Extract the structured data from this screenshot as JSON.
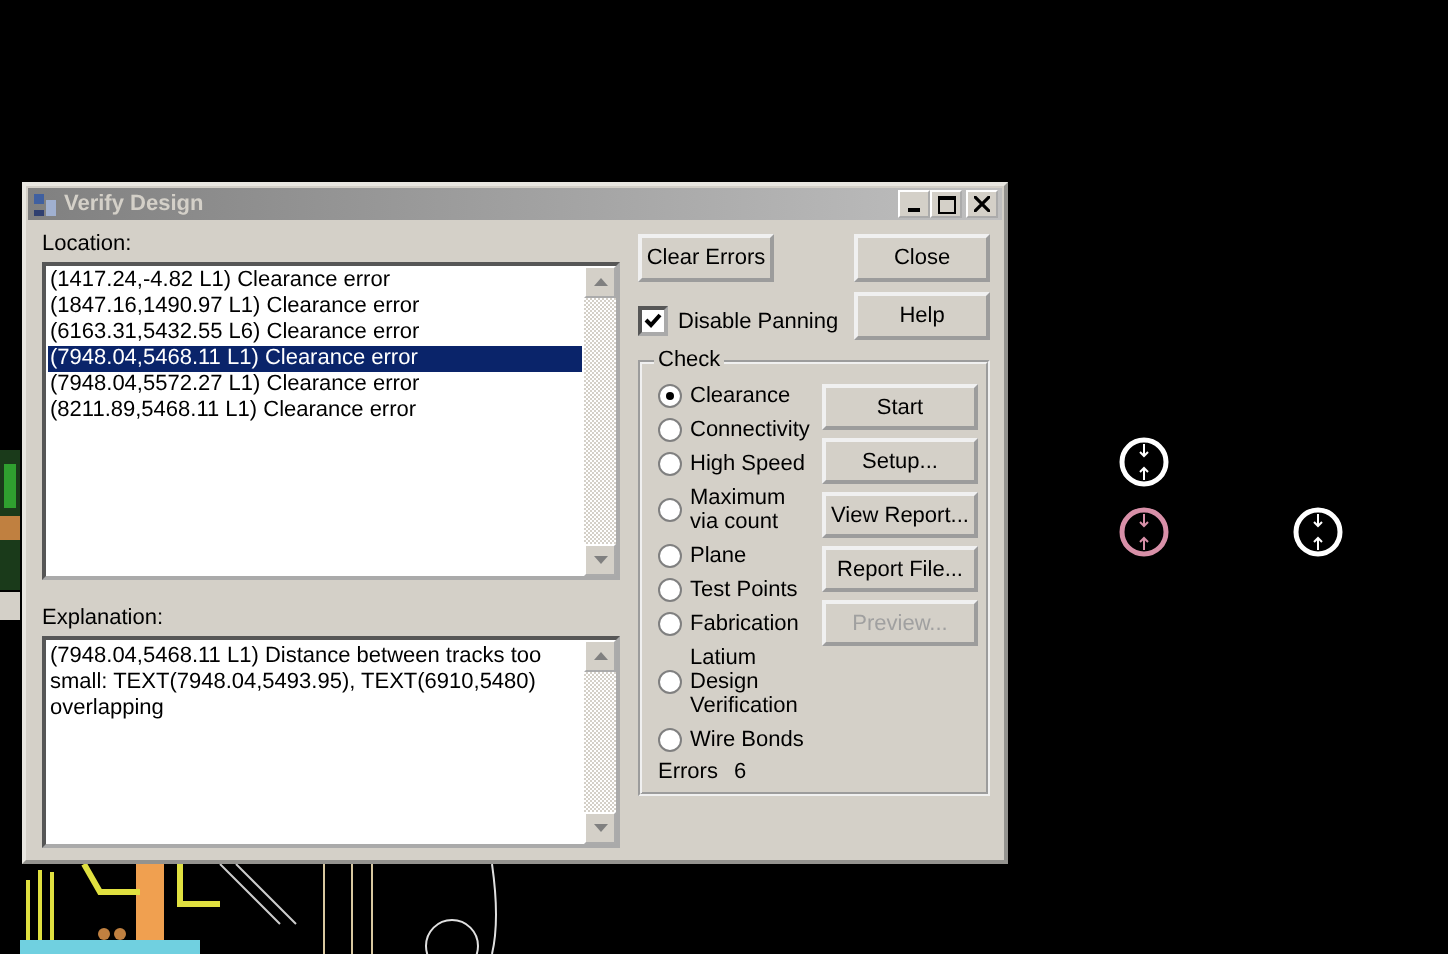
{
  "window": {
    "title": "Verify Design",
    "active": false
  },
  "location": {
    "label": "Location:",
    "items": [
      {
        "text": "(1417.24,-4.82 L1) Clearance error",
        "selected": false
      },
      {
        "text": "(1847.16,1490.97 L1) Clearance error",
        "selected": false
      },
      {
        "text": "(6163.31,5432.55 L6) Clearance error",
        "selected": false
      },
      {
        "text": "(7948.04,5468.11 L1) Clearance error",
        "selected": true
      },
      {
        "text": "(7948.04,5572.27 L1) Clearance error",
        "selected": false
      },
      {
        "text": "(8211.89,5468.11 L1) Clearance error",
        "selected": false
      }
    ]
  },
  "explanation": {
    "label": "Explanation:",
    "text": "(7948.04,5468.11 L1) Distance between tracks too small: TEXT(7948.04,5493.95), TEXT(6910,5480) overlapping"
  },
  "clear_errors_button": "Clear Errors",
  "close_button": "Close",
  "help_button": "Help",
  "disable_panning": {
    "label": "Disable Panning",
    "checked": true
  },
  "check": {
    "label": "Check",
    "options": [
      {
        "label": "Clearance",
        "selected": true
      },
      {
        "label": "Connectivity",
        "selected": false
      },
      {
        "label": "High Speed",
        "selected": false
      },
      {
        "label": "Maximum via count",
        "selected": false
      },
      {
        "label": "Plane",
        "selected": false
      },
      {
        "label": "Test Points",
        "selected": false
      },
      {
        "label": "Fabrication",
        "selected": false
      },
      {
        "label": "Latium Design Verification",
        "selected": false
      },
      {
        "label": "Wire Bonds",
        "selected": false
      }
    ],
    "actions": [
      {
        "label": "Start",
        "disabled": false
      },
      {
        "label": "Setup...",
        "disabled": false
      },
      {
        "label": "View Report...",
        "disabled": false
      },
      {
        "label": "Report File...",
        "disabled": false
      },
      {
        "label": "Preview...",
        "disabled": true
      }
    ],
    "errors_label": "Errors",
    "errors_count": "6"
  }
}
